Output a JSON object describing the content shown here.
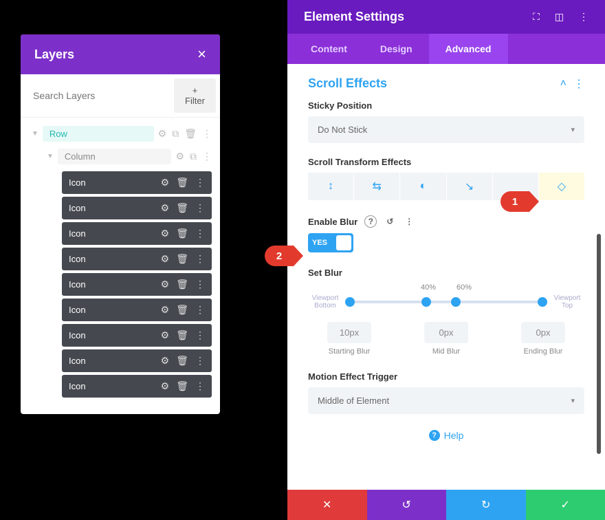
{
  "layers": {
    "title": "Layers",
    "search_placeholder": "Search Layers",
    "filter_label": "+ Filter",
    "row_label": "Row",
    "column_label": "Column",
    "items": [
      {
        "label": "Icon"
      },
      {
        "label": "Icon"
      },
      {
        "label": "Icon"
      },
      {
        "label": "Icon"
      },
      {
        "label": "Icon"
      },
      {
        "label": "Icon"
      },
      {
        "label": "Icon"
      },
      {
        "label": "Icon"
      },
      {
        "label": "Icon"
      }
    ]
  },
  "settings": {
    "title": "Element Settings",
    "tabs": {
      "content": "Content",
      "design": "Design",
      "advanced": "Advanced"
    },
    "section": "Scroll Effects",
    "sticky": {
      "label": "Sticky Position",
      "value": "Do Not Stick"
    },
    "transform_label": "Scroll Transform Effects",
    "enable_blur": {
      "label": "Enable Blur",
      "value": "YES"
    },
    "set_blur": {
      "label": "Set Blur",
      "p1": "40%",
      "p2": "60%",
      "vp_bottom": "Viewport Bottom",
      "vp_top": "Viewport Top",
      "start_val": "10px",
      "start_cap": "Starting Blur",
      "mid_val": "0px",
      "mid_cap": "Mid Blur",
      "end_val": "0px",
      "end_cap": "Ending Blur"
    },
    "motion": {
      "label": "Motion Effect Trigger",
      "value": "Middle of Element"
    },
    "help": "Help"
  },
  "callouts": {
    "one": "1",
    "two": "2"
  }
}
